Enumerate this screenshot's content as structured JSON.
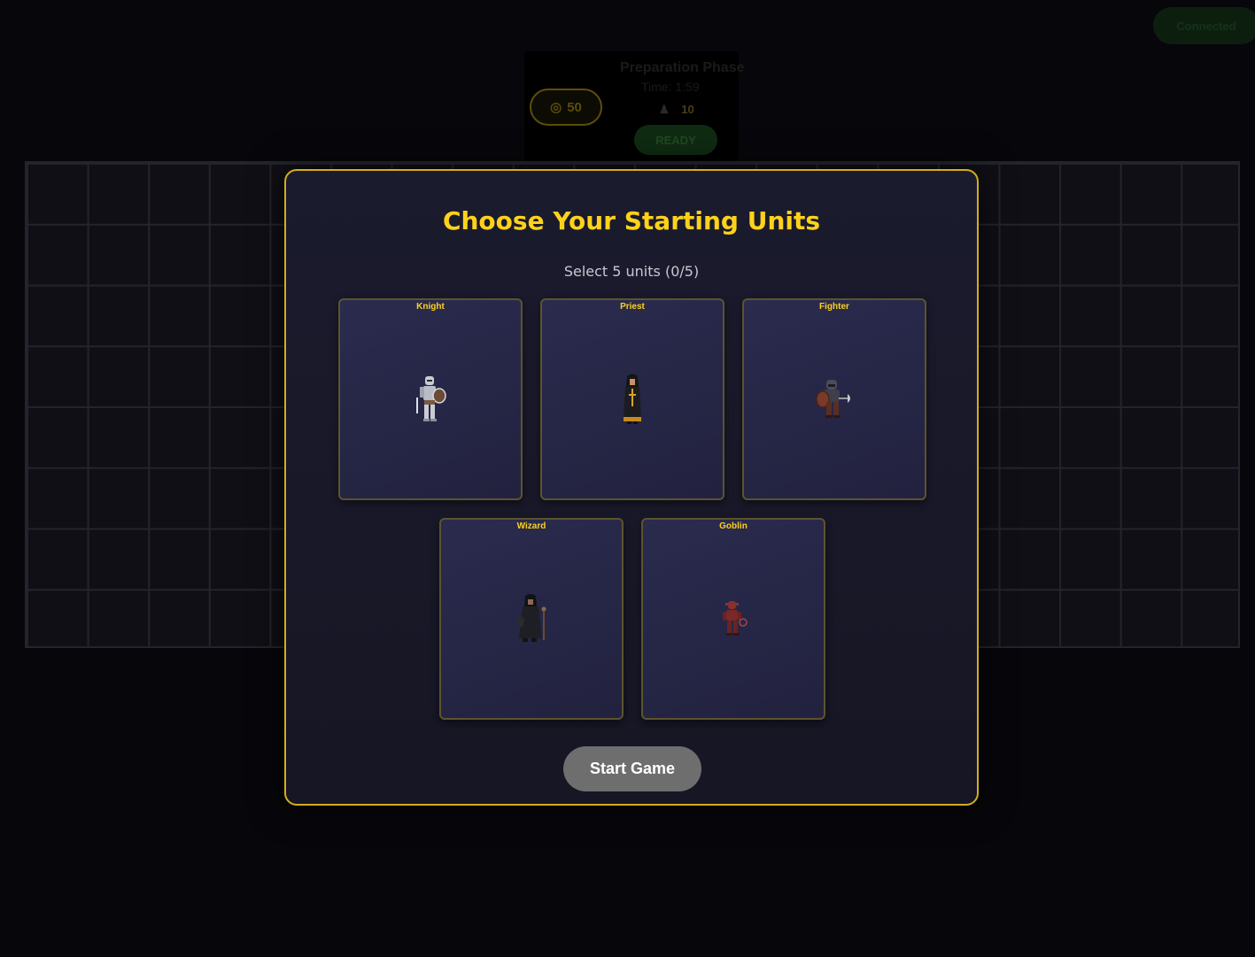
{
  "background": {
    "gold_amount": "50",
    "phase_title": "Preparation Phase",
    "phase_timer": "Time: 1:59",
    "unit_cost": "10",
    "ready_label": "READY",
    "top_right_label": "Connected"
  },
  "modal": {
    "title": "Choose Your Starting Units",
    "subtitle": "Select 5 units (0/5)",
    "units": [
      {
        "name": "Knight"
      },
      {
        "name": "Priest"
      },
      {
        "name": "Fighter"
      },
      {
        "name": "Wizard"
      },
      {
        "name": "Goblin"
      }
    ],
    "start_label": "Start Game"
  },
  "colors": {
    "accent_gold": "#ffd21a",
    "modal_border": "#d4ad1b",
    "card_border": "#5c532f",
    "start_button": "#6e6e6e"
  }
}
